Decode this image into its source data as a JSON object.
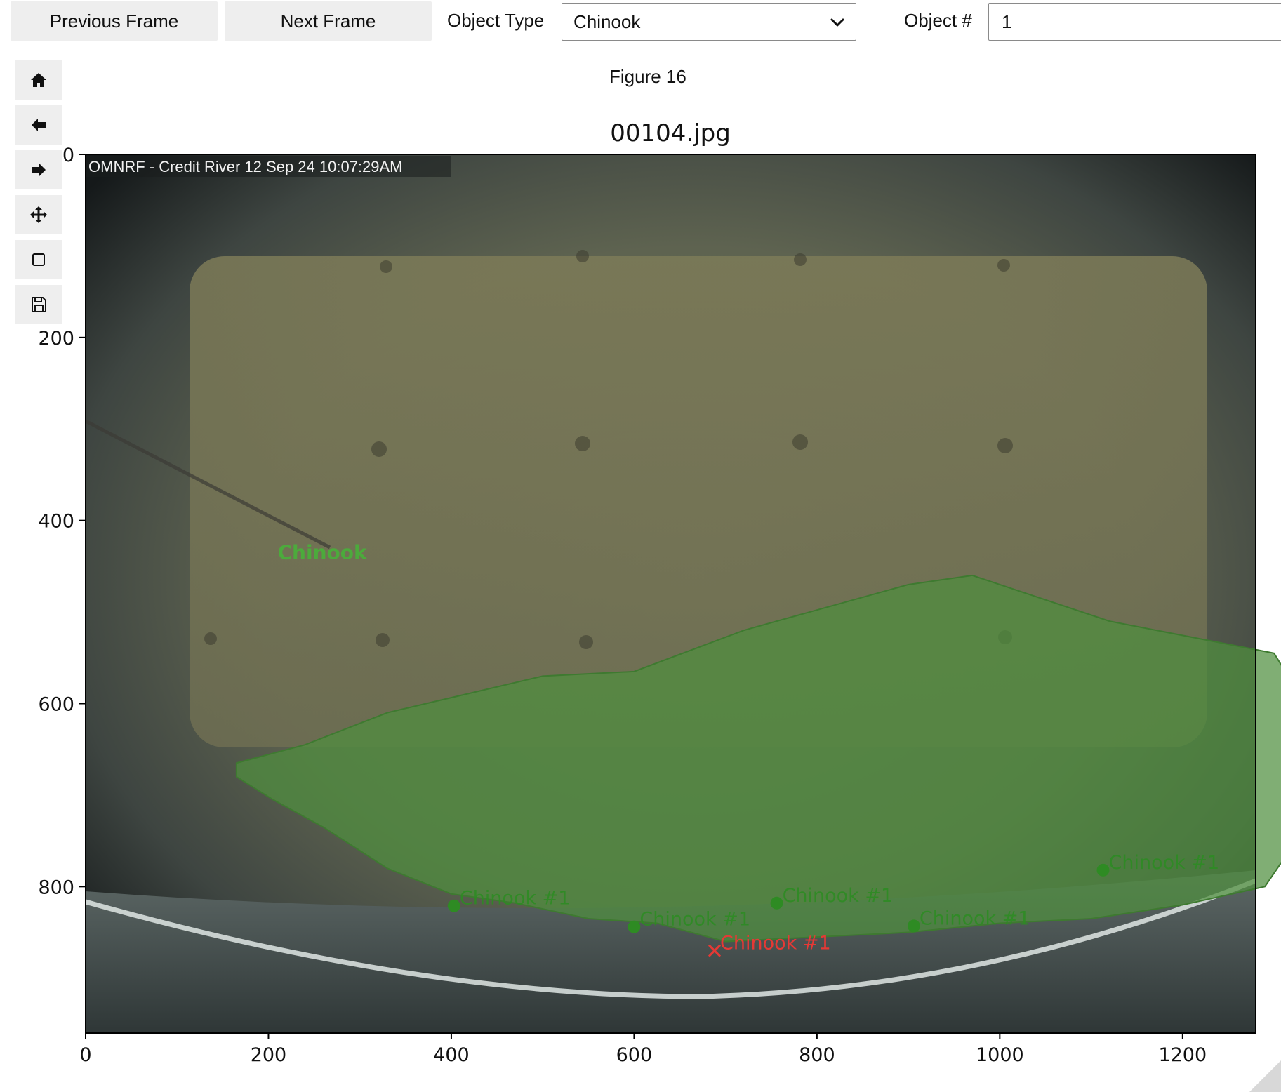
{
  "toolbar": {
    "prev_label": "Previous Frame",
    "next_label": "Next Frame",
    "object_type_label": "Object Type",
    "object_type_value": "Chinook",
    "object_num_label": "Object #",
    "object_num_value": "1"
  },
  "nav_tools": [
    {
      "name": "home-icon"
    },
    {
      "name": "back-arrow-icon"
    },
    {
      "name": "forward-arrow-icon"
    },
    {
      "name": "pan-move-icon"
    },
    {
      "name": "zoom-rect-icon"
    },
    {
      "name": "save-icon"
    }
  ],
  "figure": {
    "figure_title": "Figure 16",
    "plot_title": "00104.jpg",
    "overlay_caption": "OMNRF - Credit River 12 Sep 24 10:07:29AM",
    "class_label": "Chinook",
    "class_label_color": "#4caa3c",
    "mask_color": "#4f8f3e",
    "point_color": "#2e8b23",
    "active_color": "#e53935"
  },
  "chart_data": {
    "type": "scatter",
    "title": "00104.jpg",
    "xlabel": "",
    "ylabel": "",
    "xlim": [
      0,
      1280
    ],
    "ylim": [
      960,
      0
    ],
    "x_ticks": [
      0,
      200,
      400,
      600,
      800,
      1000,
      1200
    ],
    "y_ticks": [
      0,
      200,
      400,
      600,
      800
    ],
    "class_label_pos": [
      210,
      442
    ],
    "mask_polygon": [
      [
        165,
        665
      ],
      [
        240,
        645
      ],
      [
        330,
        610
      ],
      [
        500,
        570
      ],
      [
        600,
        565
      ],
      [
        720,
        520
      ],
      [
        900,
        470
      ],
      [
        970,
        460
      ],
      [
        1000,
        470
      ],
      [
        1120,
        510
      ],
      [
        1300,
        545
      ],
      [
        1340,
        610
      ],
      [
        1365,
        665
      ],
      [
        1355,
        705
      ],
      [
        1290,
        800
      ],
      [
        1200,
        820
      ],
      [
        1100,
        835
      ],
      [
        1000,
        840
      ],
      [
        900,
        850
      ],
      [
        800,
        855
      ],
      [
        700,
        860
      ],
      [
        625,
        840
      ],
      [
        550,
        835
      ],
      [
        470,
        818
      ],
      [
        400,
        808
      ],
      [
        330,
        780
      ],
      [
        260,
        735
      ],
      [
        205,
        705
      ],
      [
        165,
        680
      ]
    ],
    "points": [
      {
        "x": 403,
        "y": 821,
        "label": "Chinook #1",
        "active": false
      },
      {
        "x": 600,
        "y": 844,
        "label": "Chinook #1",
        "active": false
      },
      {
        "x": 756,
        "y": 818,
        "label": "Chinook #1",
        "active": false
      },
      {
        "x": 906,
        "y": 843,
        "label": "Chinook #1",
        "active": false
      },
      {
        "x": 1113,
        "y": 782,
        "label": "Chinook #1",
        "active": false
      },
      {
        "x": 688,
        "y": 870,
        "label": "Chinook #1",
        "active": true
      }
    ]
  }
}
